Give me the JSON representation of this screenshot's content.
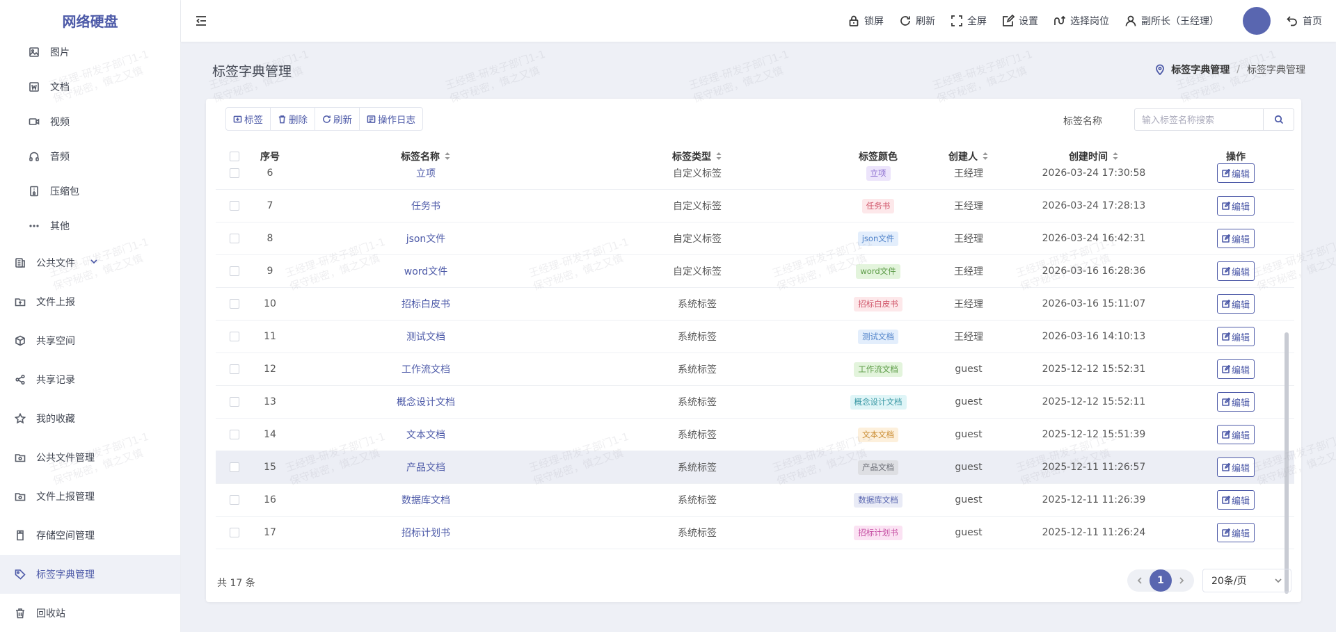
{
  "sidebar": {
    "logo": "网络硬盘",
    "sub_items": [
      {
        "label": "图片",
        "icon": "image-icon"
      },
      {
        "label": "文档",
        "icon": "document-icon"
      },
      {
        "label": "视频",
        "icon": "video-icon"
      },
      {
        "label": "音频",
        "icon": "headphones-icon"
      },
      {
        "label": "压缩包",
        "icon": "archive-icon"
      },
      {
        "label": "其他",
        "icon": "more-icon"
      }
    ],
    "items": [
      {
        "label": "公共文件",
        "icon": "public-files-icon"
      },
      {
        "label": "文件上报",
        "icon": "upload-folder-icon"
      },
      {
        "label": "共享空间",
        "icon": "cube-icon"
      },
      {
        "label": "共享记录",
        "icon": "share-icon"
      },
      {
        "label": "我的收藏",
        "icon": "star-icon"
      },
      {
        "label": "公共文件管理",
        "icon": "folder-manage-icon"
      },
      {
        "label": "文件上报管理",
        "icon": "folder-manage-icon"
      },
      {
        "label": "存储空间管理",
        "icon": "storage-icon"
      },
      {
        "label": "标签字典管理",
        "icon": "tag-icon"
      },
      {
        "label": "回收站",
        "icon": "trash-icon"
      }
    ]
  },
  "topbar": {
    "lock": "锁屏",
    "refresh": "刷新",
    "fullscreen": "全屏",
    "settings": "设置",
    "select_post": "选择岗位",
    "user": "副所长（王经理）",
    "home": "首页"
  },
  "page": {
    "title": "标签字典管理",
    "breadcrumb": [
      "标签字典管理",
      "/",
      "标签字典管理"
    ]
  },
  "toolbar": {
    "add": "标签",
    "delete": "删除",
    "refresh": "刷新",
    "log": "操作日志"
  },
  "search": {
    "label": "标签名称",
    "placeholder": "输入标签名称搜索"
  },
  "table": {
    "headers": {
      "index": "序号",
      "name": "标签名称",
      "type": "标签类型",
      "color": "标签颜色",
      "creator": "创建人",
      "time": "创建时间",
      "op": "操作"
    },
    "edit_label": "编辑",
    "rows": [
      {
        "index": "6",
        "name": "立项",
        "type": "自定义标签",
        "tag": "立项",
        "tag_bg": "#ece4fb",
        "tag_fg": "#8a6ccf",
        "creator": "王经理",
        "time": "2026-03-24 17:30:58"
      },
      {
        "index": "7",
        "name": "任务书",
        "type": "自定义标签",
        "tag": "任务书",
        "tag_bg": "#fde8ea",
        "tag_fg": "#d0566a",
        "creator": "王经理",
        "time": "2026-03-24 17:28:13"
      },
      {
        "index": "8",
        "name": "json文件",
        "type": "自定义标签",
        "tag": "json文件",
        "tag_bg": "#e3eefc",
        "tag_fg": "#4f82c9",
        "creator": "王经理",
        "time": "2026-03-24 16:42:31"
      },
      {
        "index": "9",
        "name": "word文件",
        "type": "自定义标签",
        "tag": "word文件",
        "tag_bg": "#e3f4dc",
        "tag_fg": "#5a9a44",
        "creator": "王经理",
        "time": "2026-03-16 16:28:36"
      },
      {
        "index": "10",
        "name": "招标白皮书",
        "type": "系统标签",
        "tag": "招标白皮书",
        "tag_bg": "#fde8ea",
        "tag_fg": "#d0566a",
        "creator": "王经理",
        "time": "2026-03-16 15:11:07"
      },
      {
        "index": "11",
        "name": "测试文档",
        "type": "系统标签",
        "tag": "测试文档",
        "tag_bg": "#e3eefc",
        "tag_fg": "#4f82c9",
        "creator": "王经理",
        "time": "2026-03-16 14:10:13"
      },
      {
        "index": "12",
        "name": "工作流文档",
        "type": "系统标签",
        "tag": "工作流文档",
        "tag_bg": "#e3f4dc",
        "tag_fg": "#5a9a44",
        "creator": "guest",
        "time": "2025-12-12 15:52:31"
      },
      {
        "index": "13",
        "name": "概念设计文档",
        "type": "系统标签",
        "tag": "概念设计文档",
        "tag_bg": "#dff5f7",
        "tag_fg": "#3d9aa6",
        "creator": "guest",
        "time": "2025-12-12 15:52:11"
      },
      {
        "index": "14",
        "name": "文本文档",
        "type": "系统标签",
        "tag": "文本文档",
        "tag_bg": "#fdf0dc",
        "tag_fg": "#c98a2e",
        "creator": "guest",
        "time": "2025-12-12 15:51:39"
      },
      {
        "index": "15",
        "name": "产品文档",
        "type": "系统标签",
        "tag": "产品文档",
        "tag_bg": "#dedfe3",
        "tag_fg": "#6a6d75",
        "creator": "guest",
        "time": "2025-12-11 11:26:57"
      },
      {
        "index": "16",
        "name": "数据库文档",
        "type": "系统标签",
        "tag": "数据库文档",
        "tag_bg": "#e9ebf6",
        "tag_fg": "#5966b0",
        "creator": "guest",
        "time": "2025-12-11 11:26:39"
      },
      {
        "index": "17",
        "name": "招标计划书",
        "type": "系统标签",
        "tag": "招标计划书",
        "tag_bg": "#fbe2f3",
        "tag_fg": "#c44aa0",
        "creator": "guest",
        "time": "2025-12-11 11:26:24"
      }
    ]
  },
  "footer": {
    "total": "共 17 条",
    "current_page": "1",
    "page_size": "20条/页"
  },
  "watermark": {
    "line1": "王经理-研发子部门1-1",
    "line2": "保守秘密，慎之又慎"
  },
  "colors": {
    "accent": "#4d5aa8",
    "avatar": "#5966b0"
  }
}
